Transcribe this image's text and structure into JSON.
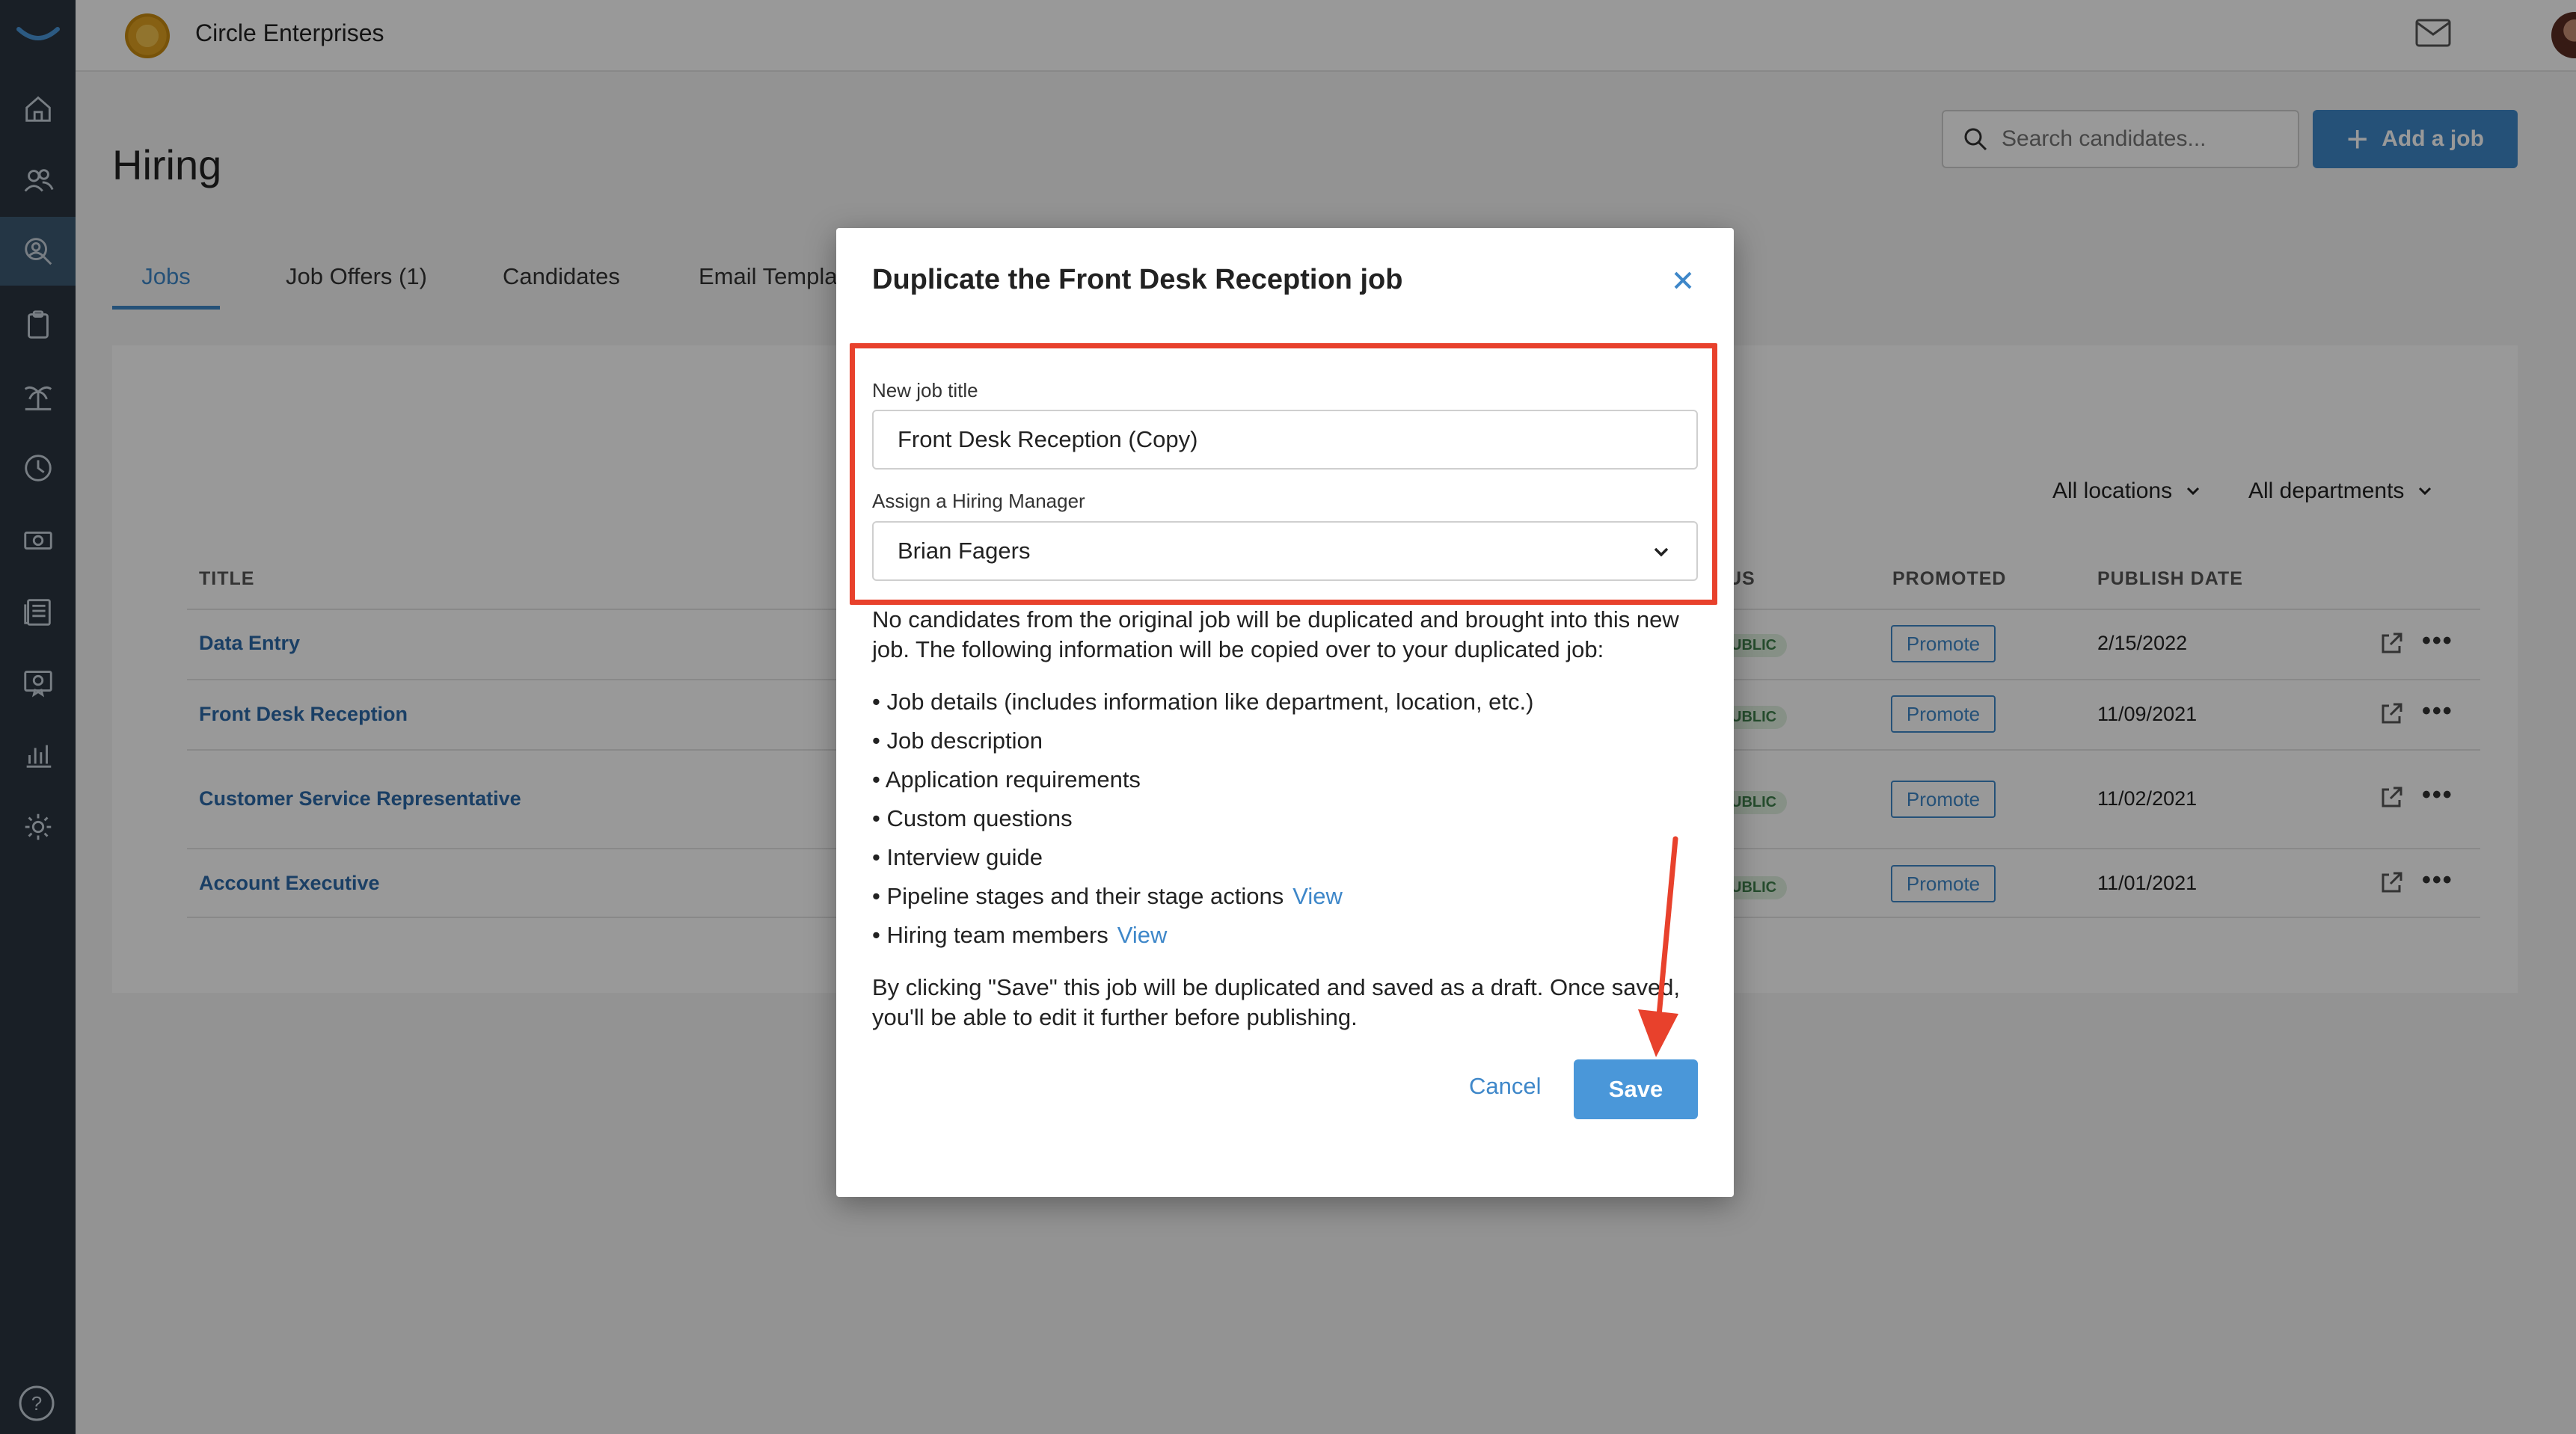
{
  "topbar": {
    "company_name": "Circle Enterprises"
  },
  "sidebar": {
    "items": [
      {
        "icon": "home-icon"
      },
      {
        "icon": "people-icon"
      },
      {
        "icon": "hiring-search-icon",
        "active": true
      },
      {
        "icon": "clipboard-icon"
      },
      {
        "icon": "palm-tree-icon"
      },
      {
        "icon": "clock-icon"
      },
      {
        "icon": "money-icon"
      },
      {
        "icon": "news-icon"
      },
      {
        "icon": "certificate-icon"
      },
      {
        "icon": "chart-icon"
      },
      {
        "icon": "gear-icon"
      }
    ],
    "help_icon": "help-icon"
  },
  "page": {
    "title": "Hiring",
    "search_placeholder": "Search candidates...",
    "add_job_label": "Add a job",
    "tabs": [
      "Jobs",
      "Job Offers (1)",
      "Candidates",
      "Email Templa"
    ],
    "filters": {
      "locations": "All locations",
      "departments": "All departments"
    },
    "table": {
      "headers": {
        "title": "TITLE",
        "status": "US",
        "promoted": "PROMOTED",
        "publish_date": "PUBLISH DATE"
      },
      "rows": [
        {
          "title": "Data Entry",
          "status": "UBLIC",
          "promote": "Promote",
          "date": "2/15/2022"
        },
        {
          "title": "Front Desk Reception",
          "status": "UBLIC",
          "promote": "Promote",
          "date": "11/09/2021"
        },
        {
          "title": "Customer Service Representative",
          "status": "UBLIC",
          "promote": "Promote",
          "date": "11/02/2021"
        },
        {
          "title": "Account Executive",
          "status": "UBLIC",
          "promote": "Promote",
          "date": "11/01/2021"
        }
      ]
    }
  },
  "modal": {
    "title": "Duplicate the Front Desk Reception job",
    "job_title_label": "New job title",
    "job_title_value": "Front Desk Reception (Copy)",
    "manager_label": "Assign a Hiring Manager",
    "manager_value": "Brian Fagers",
    "intro": "No candidates from the original job will be duplicated and brought into this new job. The following information will be copied over to your duplicated job:",
    "bullets": [
      {
        "text": "• Job details (includes information like department, location, etc.)"
      },
      {
        "text": "• Job description"
      },
      {
        "text": "• Application requirements"
      },
      {
        "text": "• Custom questions"
      },
      {
        "text": "• Interview guide"
      },
      {
        "text": "• Pipeline stages and their stage actions",
        "link": "View"
      },
      {
        "text": "• Hiring team members",
        "link": "View"
      }
    ],
    "footer_note": "By clicking \"Save\" this job will be duplicated and saved as a draft. Once saved, you'll be able to edit it further before publishing.",
    "cancel_label": "Cancel",
    "save_label": "Save"
  },
  "colors": {
    "accent": "#3e87c9",
    "sidebar": "#2a3540",
    "highlight": "#e8412c"
  }
}
